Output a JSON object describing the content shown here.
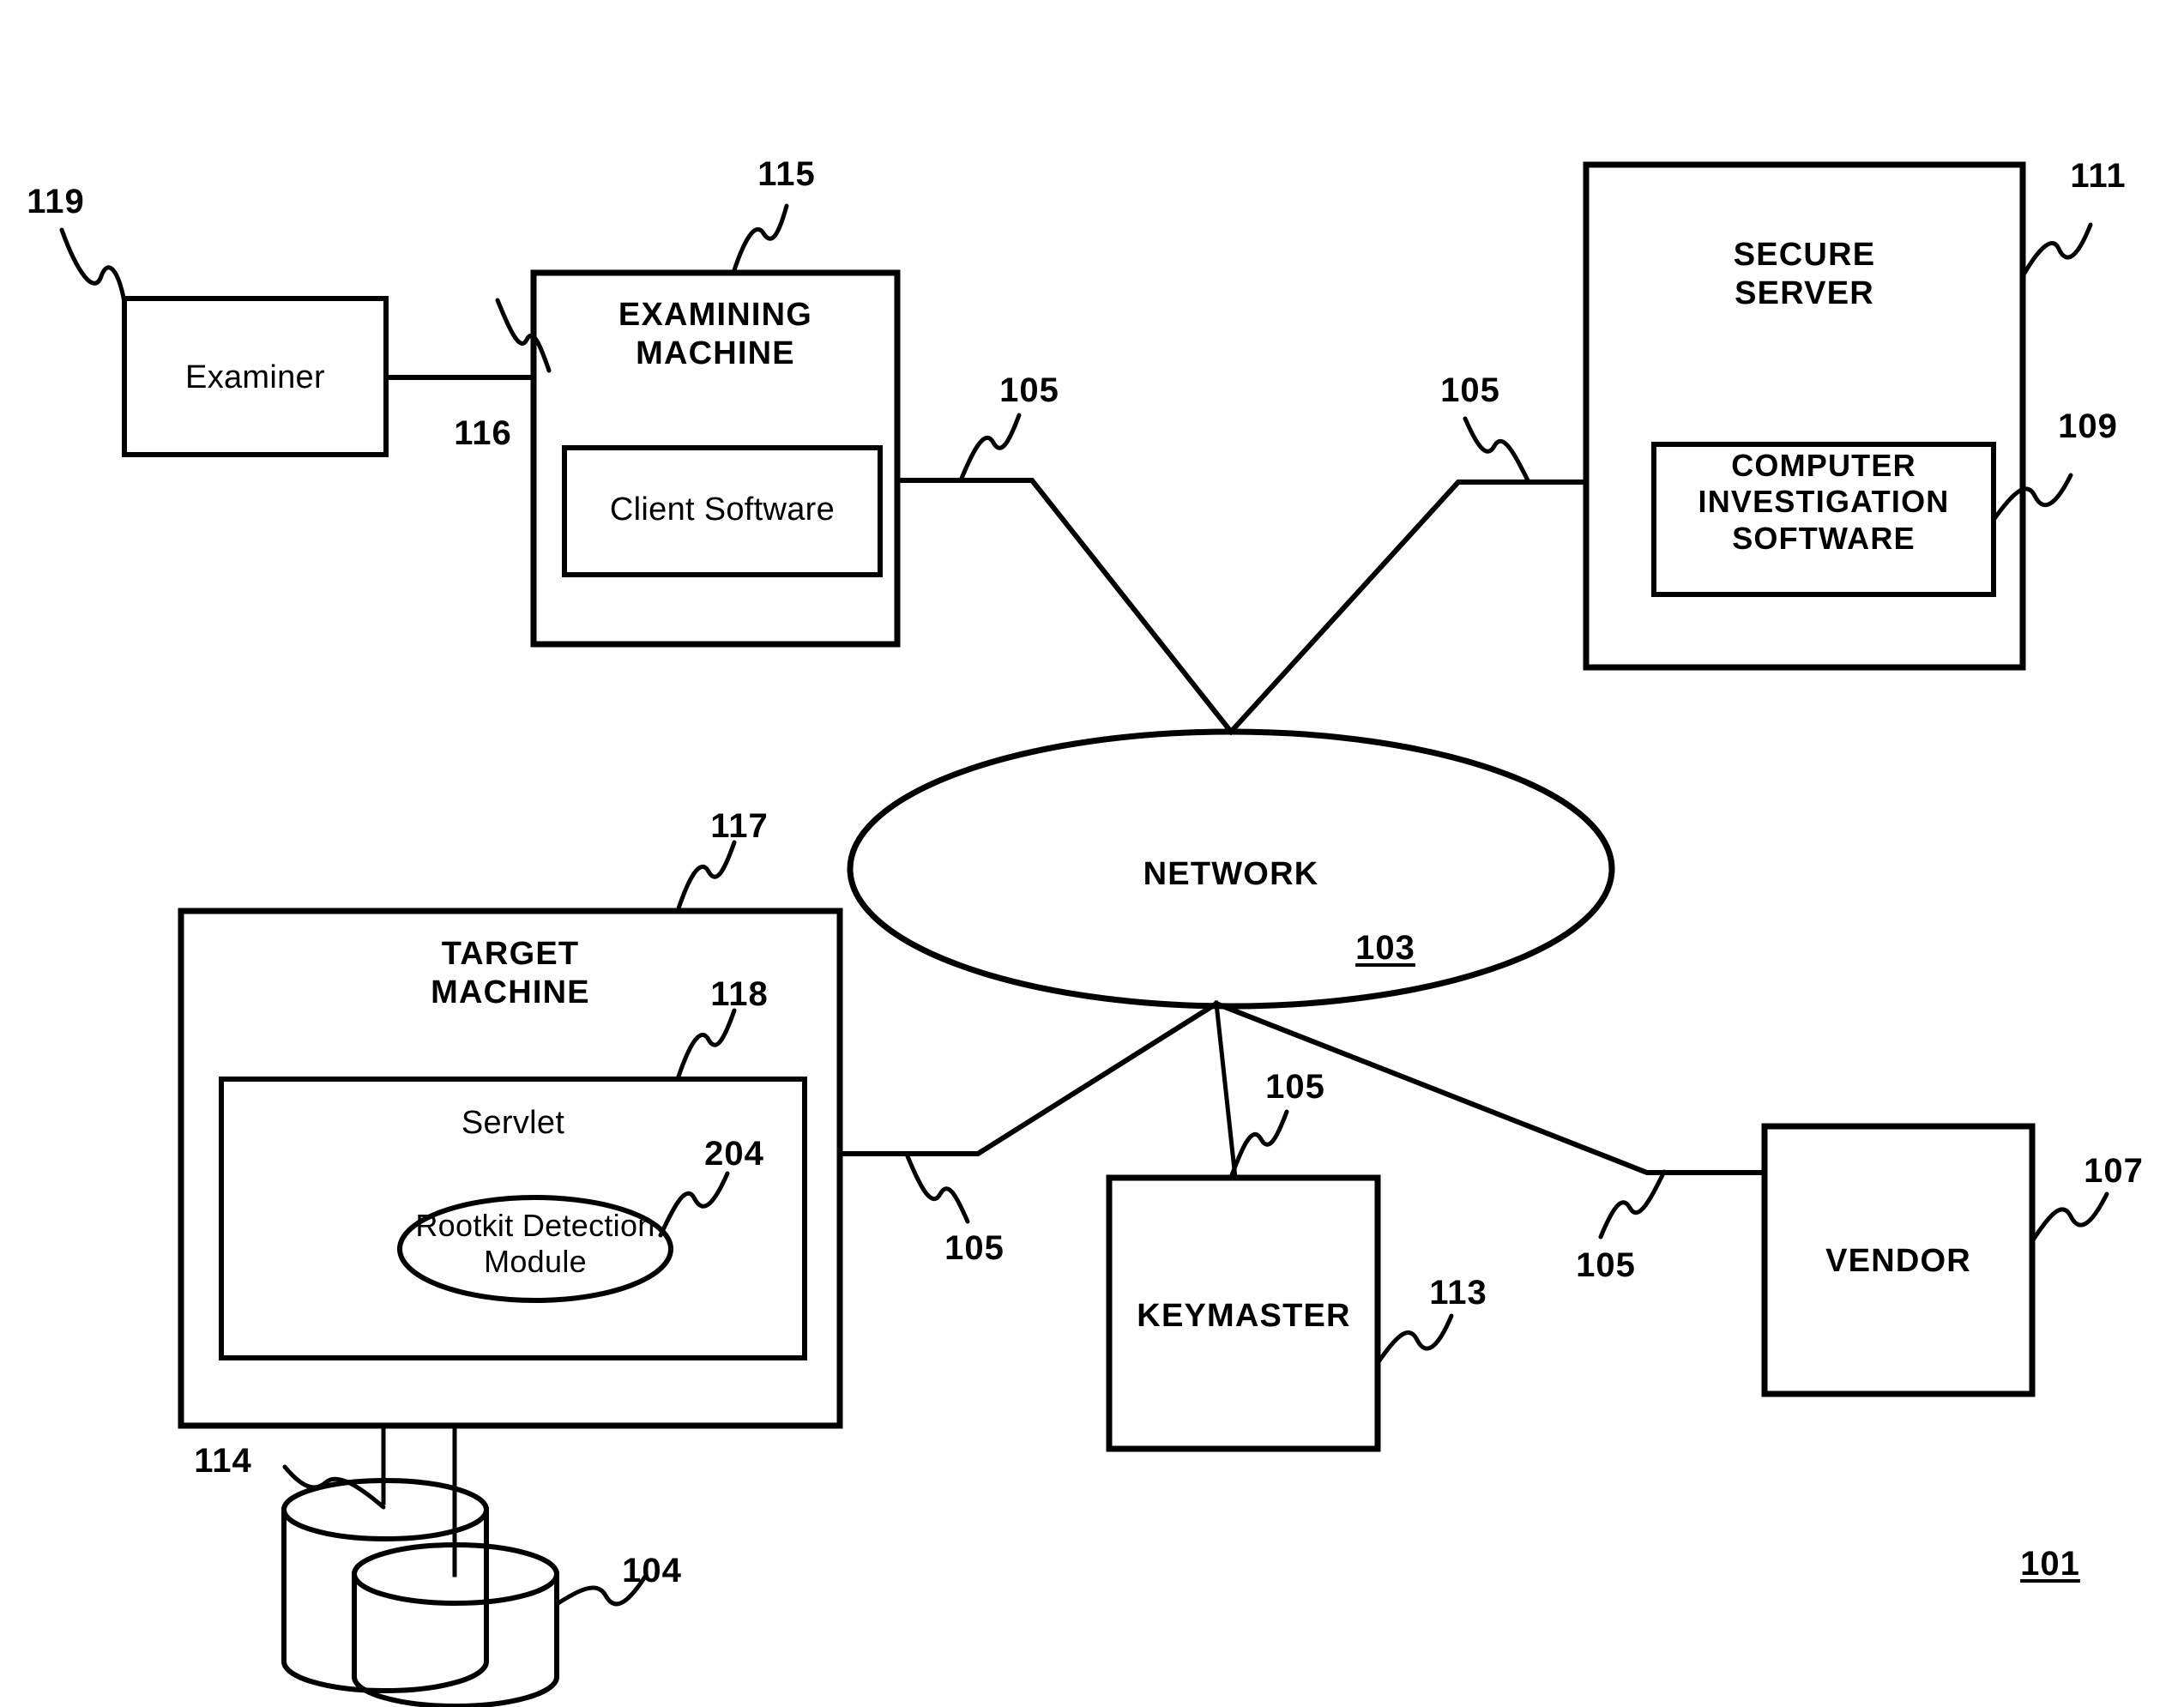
{
  "figure": {
    "figure_numeral": "101",
    "nodes": {
      "examiner": {
        "label": "Examiner",
        "numeral": "119"
      },
      "examining_machine": {
        "label": "EXAMINING\nMACHINE",
        "numeral": "115"
      },
      "client_software": {
        "label": "Client Software",
        "numeral": "116"
      },
      "secure_server": {
        "label": "SECURE\nSERVER",
        "numeral": "111"
      },
      "computer_investigation_software": {
        "label": "COMPUTER\nINVESTIGATION\nSOFTWARE",
        "numeral": "109"
      },
      "network": {
        "label": "NETWORK",
        "numeral": "103"
      },
      "target_machine": {
        "label": "TARGET\nMACHINE",
        "numeral": "117"
      },
      "servlet": {
        "label": "Servlet",
        "numeral": "118"
      },
      "rootkit_detection_module": {
        "label": "Rootkit Detection\nModule",
        "numeral": "204"
      },
      "keymaster": {
        "label": "KEYMASTER",
        "numeral": "113"
      },
      "vendor": {
        "label": "VENDOR",
        "numeral": "107"
      },
      "storage_upper": {
        "label": "",
        "numeral": "114"
      },
      "storage_lower": {
        "label": "",
        "numeral": "104"
      }
    },
    "links": {
      "examining_machine_to_network": "105",
      "secure_server_to_network": "105",
      "target_machine_to_network": "105",
      "keymaster_to_network": "105",
      "vendor_to_network": "105"
    },
    "colors": {
      "ink": "#000000",
      "paper": "#ffffff"
    }
  }
}
